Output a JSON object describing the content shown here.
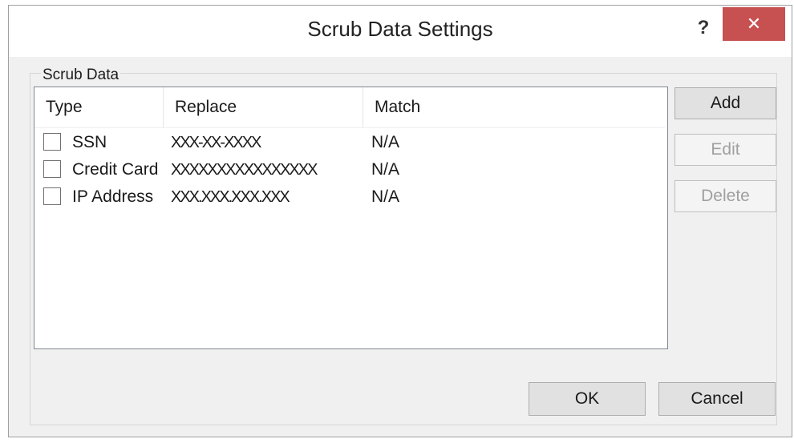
{
  "window": {
    "title": "Scrub Data Settings",
    "help_label": "?",
    "close_label": "✕"
  },
  "group": {
    "legend": "Scrub Data"
  },
  "list": {
    "columns": [
      "Type",
      "Replace",
      "Match"
    ],
    "rows": [
      {
        "checked": false,
        "type": "SSN",
        "replace": "XXX-XX-XXXX",
        "match": "N/A"
      },
      {
        "checked": false,
        "type": "Credit Card",
        "replace": "XXXXXXXXXXXXXXXX",
        "match": "N/A"
      },
      {
        "checked": false,
        "type": "IP Address",
        "replace": "XXX.XXX.XXX.XXX",
        "match": "N/A"
      }
    ]
  },
  "buttons": {
    "add": {
      "label": "Add",
      "enabled": true
    },
    "edit": {
      "label": "Edit",
      "enabled": false
    },
    "delete": {
      "label": "Delete",
      "enabled": false
    },
    "ok": {
      "label": "OK"
    },
    "cancel": {
      "label": "Cancel"
    }
  },
  "colors": {
    "close_button_bg": "#c75050",
    "dialog_bg": "#f0f0f0"
  },
  "icons": {
    "help": "question-mark-icon",
    "close": "close-icon"
  }
}
